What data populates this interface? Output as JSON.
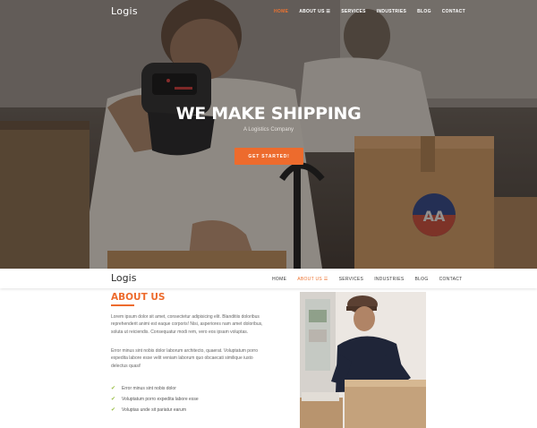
{
  "brand": {
    "logo": "Logis",
    "accent": "#ed6b2d"
  },
  "nav": {
    "items": [
      {
        "label": "HOME",
        "active": true
      },
      {
        "label": "ABOUT US",
        "has_dropdown": true
      },
      {
        "label": "SERVICES"
      },
      {
        "label": "INDUSTRIES"
      },
      {
        "label": "BLOG"
      },
      {
        "label": "CONTACT"
      }
    ]
  },
  "sticky_nav": {
    "items": [
      {
        "label": "HOME"
      },
      {
        "label": "ABOUT US",
        "active": true
      },
      {
        "label": "SERVICES"
      },
      {
        "label": "INDUSTRIES"
      },
      {
        "label": "BLOG"
      },
      {
        "label": "CONTACT"
      }
    ]
  },
  "hero": {
    "title": "WE MAKE SHIPPING",
    "subtitle": "A Logistics Company",
    "cta": "GET STARTED!",
    "box_badge": "AA"
  },
  "about": {
    "title": "ABOUT US",
    "p1": "Lorem ipsum dolor sit amet, consectetur adipisicing elit. Blanditiis doloribus reprehenderit animi est eaque corporis! Nisi, asperiores nam amet doloribus, soluta ut reiciendis. Consequatur modi rem, vero eos ipsam voluptas.",
    "p2": "Error minus sint nobis dolor laborum architecto, quaerat. Voluptatum porro expedita labore esse velit veniam laborum quo obcaecati similique iusto delectus quasi!",
    "checklist": [
      "Error minus sint nobis dolor",
      "Voluptatum porro expedita labore esse",
      "Voluptas unde sit pariatur earum"
    ]
  }
}
